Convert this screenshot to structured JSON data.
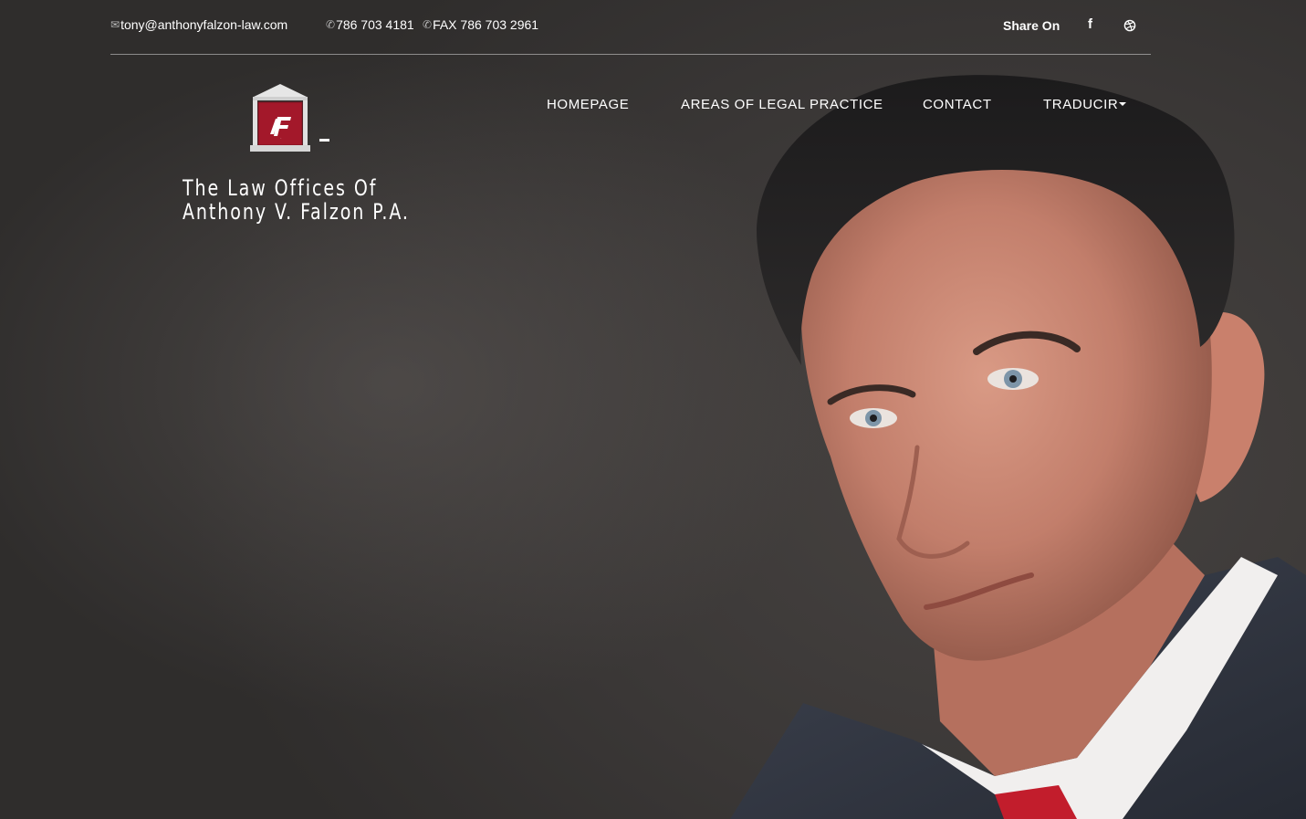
{
  "topbar": {
    "email_icon": "envelope-icon",
    "email": "tony@anthonyfalzon-law.com",
    "phone_icon": "phone-icon",
    "phone": "786 703 4181",
    "fax_icon": "phone-icon",
    "fax": "FAX 786 703 2961",
    "share_label": "Share On",
    "social": [
      {
        "name": "facebook-icon",
        "glyph": "f"
      },
      {
        "name": "dribbble-icon"
      }
    ]
  },
  "brand": {
    "logo_icon": "courthouse-logo",
    "logo_letters": "AF",
    "line1": "The Law Offices Of",
    "line2": "Anthony V. Falzon P.A."
  },
  "nav": {
    "items": [
      {
        "label": "HOMEPAGE"
      },
      {
        "label": "AREAS OF LEGAL PRACTICE"
      },
      {
        "label": "CONTACT"
      },
      {
        "label": "TRADUCIR"
      }
    ]
  },
  "colors": {
    "background": "#3b3837",
    "text": "#ffffff",
    "logo_red": "#a3182a"
  }
}
